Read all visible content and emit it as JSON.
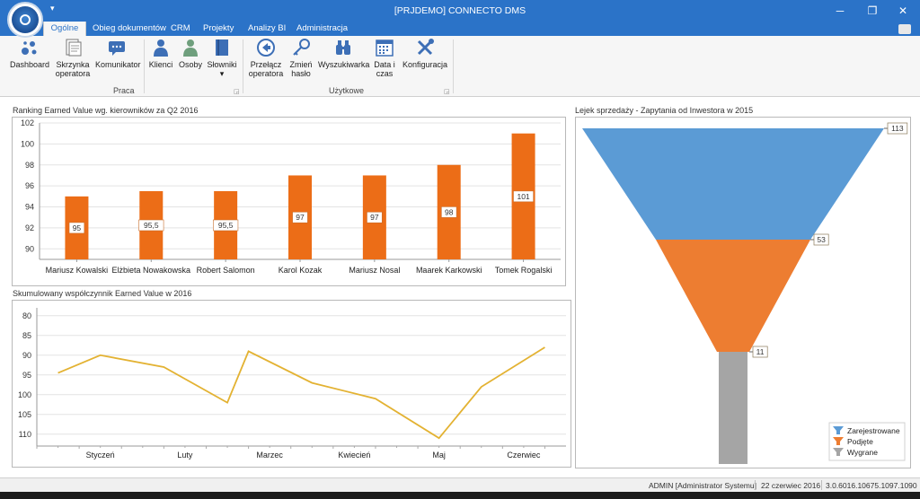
{
  "window": {
    "title": "[PRJDEMO] CONNECTO DMS",
    "qat_glyph": "▾",
    "minimize_glyph": "─",
    "maximize_glyph": "❐",
    "close_glyph": "✕"
  },
  "tabs": [
    {
      "label": "Ogólne",
      "active": true
    },
    {
      "label": "Obieg dokumentów"
    },
    {
      "label": "CRM"
    },
    {
      "label": "Projekty"
    },
    {
      "label": "Analizy BI"
    },
    {
      "label": "Administracja"
    }
  ],
  "ribbon": {
    "groups": {
      "praca": "Praca",
      "uzytkowe": "Użytkowe"
    },
    "launcher_glyph": "◲",
    "buttons": {
      "dashboard": {
        "line1": "Dashboard",
        "line2": "",
        "icon": "dashboard-icon"
      },
      "skrzynka": {
        "line1": "Skrzynka",
        "line2": "operatora",
        "icon": "inbox-icon"
      },
      "komunikator": {
        "line1": "Komunikator",
        "line2": "",
        "icon": "chat-icon"
      },
      "klienci": {
        "line1": "Klienci",
        "line2": "",
        "icon": "client-icon"
      },
      "osoby": {
        "line1": "Osoby",
        "line2": "",
        "icon": "person-icon"
      },
      "slowniki": {
        "line1": "Słowniki",
        "line2": "▾",
        "icon": "book-icon"
      },
      "przelacz": {
        "line1": "Przełącz",
        "line2": "operatora",
        "icon": "switch-icon"
      },
      "zmien_haslo": {
        "line1": "Zmień",
        "line2": "hasło",
        "icon": "key-icon"
      },
      "wyszukiwarka": {
        "line1": "Wyszukiwarka",
        "line2": "",
        "icon": "binoculars-icon"
      },
      "data_czas": {
        "line1": "Data i",
        "line2": "czas",
        "icon": "calendar-icon"
      },
      "konfiguracja": {
        "line1": "Konfiguracja",
        "line2": "",
        "icon": "tools-icon"
      }
    }
  },
  "colors": {
    "accent": "#2b73c8",
    "bar": "#ec6d17",
    "line": "#e3b232",
    "funnel_registered": "#5b9bd5",
    "funnel_taken": "#ed7d31",
    "funnel_won": "#a5a5a5"
  },
  "status": {
    "user": "ADMIN [Administrator Systemu]",
    "date": "22 czerwiec 2016",
    "version": "3.0.6016.10675.1097.1090"
  },
  "chart_data": [
    {
      "type": "bar",
      "title": "Ranking Earned Value wg. kierowników za Q2 2016",
      "categories": [
        "Mariusz Kowalski",
        "Elżbieta Nowakowska",
        "Robert Salomon",
        "Karol Kozak",
        "Mariusz Nosal",
        "Maarek Karkowski",
        "Tomek Rogalski"
      ],
      "values": [
        95,
        95.5,
        95.5,
        97,
        97,
        98,
        101
      ],
      "value_labels": [
        "95",
        "95,5",
        "95,5",
        "97",
        "97",
        "98",
        "101"
      ],
      "ylim": [
        89,
        102
      ],
      "yticks": [
        90,
        92,
        94,
        96,
        98,
        100,
        102
      ],
      "grid": true
    },
    {
      "type": "line",
      "title": "Skumulowany współczynnik Earned Value w 2016",
      "categories": [
        "Styczeń",
        "Luty",
        "Marzec",
        "Kwiecień",
        "Maj",
        "Czerwiec"
      ],
      "x": [
        0.5,
        1.5,
        3,
        4.5,
        5,
        6.5,
        8,
        9.5,
        10.5,
        12
      ],
      "values": [
        94.5,
        90,
        93,
        102,
        89,
        97,
        101,
        111,
        98,
        88
      ],
      "yticks": [
        80,
        85,
        90,
        95,
        100,
        105,
        110
      ],
      "ylim": [
        78,
        113
      ],
      "y_inverted": true,
      "grid": true
    },
    {
      "type": "funnel",
      "title": "Lejek sprzedaży - Zapytania od Inwestora w 2015",
      "stages": [
        {
          "name": "Zarejestrowane",
          "value": 113
        },
        {
          "name": "Podjęte",
          "value": 53
        },
        {
          "name": "Wygrane",
          "value": 11
        }
      ],
      "legend": "bottom-right"
    }
  ]
}
